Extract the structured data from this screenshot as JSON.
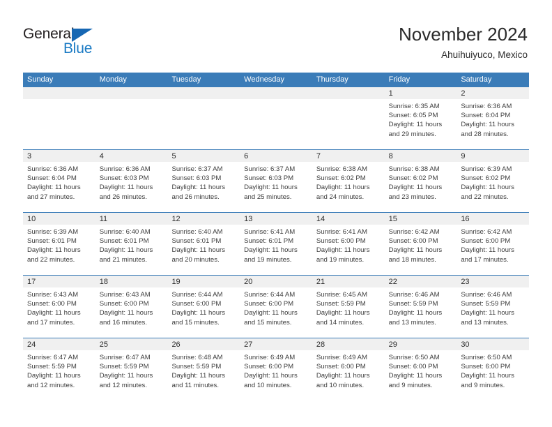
{
  "brand": {
    "name_part1": "General",
    "name_part2": "Blue",
    "triangle_color": "#1667b3",
    "blue_color": "#1a7ac4"
  },
  "header": {
    "title": "November 2024",
    "subtitle": "Ahuihuiyuco, Mexico",
    "header_bg": "#3b7cb8",
    "header_text_color": "#ffffff",
    "day_strip_bg": "#f0f0f0"
  },
  "weekdays": [
    "Sunday",
    "Monday",
    "Tuesday",
    "Wednesday",
    "Thursday",
    "Friday",
    "Saturday"
  ],
  "weeks": [
    [
      {
        "day": "",
        "sunrise": "",
        "sunset": "",
        "daylight1": "",
        "daylight2": ""
      },
      {
        "day": "",
        "sunrise": "",
        "sunset": "",
        "daylight1": "",
        "daylight2": ""
      },
      {
        "day": "",
        "sunrise": "",
        "sunset": "",
        "daylight1": "",
        "daylight2": ""
      },
      {
        "day": "",
        "sunrise": "",
        "sunset": "",
        "daylight1": "",
        "daylight2": ""
      },
      {
        "day": "",
        "sunrise": "",
        "sunset": "",
        "daylight1": "",
        "daylight2": ""
      },
      {
        "day": "1",
        "sunrise": "Sunrise: 6:35 AM",
        "sunset": "Sunset: 6:05 PM",
        "daylight1": "Daylight: 11 hours",
        "daylight2": "and 29 minutes."
      },
      {
        "day": "2",
        "sunrise": "Sunrise: 6:36 AM",
        "sunset": "Sunset: 6:04 PM",
        "daylight1": "Daylight: 11 hours",
        "daylight2": "and 28 minutes."
      }
    ],
    [
      {
        "day": "3",
        "sunrise": "Sunrise: 6:36 AM",
        "sunset": "Sunset: 6:04 PM",
        "daylight1": "Daylight: 11 hours",
        "daylight2": "and 27 minutes."
      },
      {
        "day": "4",
        "sunrise": "Sunrise: 6:36 AM",
        "sunset": "Sunset: 6:03 PM",
        "daylight1": "Daylight: 11 hours",
        "daylight2": "and 26 minutes."
      },
      {
        "day": "5",
        "sunrise": "Sunrise: 6:37 AM",
        "sunset": "Sunset: 6:03 PM",
        "daylight1": "Daylight: 11 hours",
        "daylight2": "and 26 minutes."
      },
      {
        "day": "6",
        "sunrise": "Sunrise: 6:37 AM",
        "sunset": "Sunset: 6:03 PM",
        "daylight1": "Daylight: 11 hours",
        "daylight2": "and 25 minutes."
      },
      {
        "day": "7",
        "sunrise": "Sunrise: 6:38 AM",
        "sunset": "Sunset: 6:02 PM",
        "daylight1": "Daylight: 11 hours",
        "daylight2": "and 24 minutes."
      },
      {
        "day": "8",
        "sunrise": "Sunrise: 6:38 AM",
        "sunset": "Sunset: 6:02 PM",
        "daylight1": "Daylight: 11 hours",
        "daylight2": "and 23 minutes."
      },
      {
        "day": "9",
        "sunrise": "Sunrise: 6:39 AM",
        "sunset": "Sunset: 6:02 PM",
        "daylight1": "Daylight: 11 hours",
        "daylight2": "and 22 minutes."
      }
    ],
    [
      {
        "day": "10",
        "sunrise": "Sunrise: 6:39 AM",
        "sunset": "Sunset: 6:01 PM",
        "daylight1": "Daylight: 11 hours",
        "daylight2": "and 22 minutes."
      },
      {
        "day": "11",
        "sunrise": "Sunrise: 6:40 AM",
        "sunset": "Sunset: 6:01 PM",
        "daylight1": "Daylight: 11 hours",
        "daylight2": "and 21 minutes."
      },
      {
        "day": "12",
        "sunrise": "Sunrise: 6:40 AM",
        "sunset": "Sunset: 6:01 PM",
        "daylight1": "Daylight: 11 hours",
        "daylight2": "and 20 minutes."
      },
      {
        "day": "13",
        "sunrise": "Sunrise: 6:41 AM",
        "sunset": "Sunset: 6:01 PM",
        "daylight1": "Daylight: 11 hours",
        "daylight2": "and 19 minutes."
      },
      {
        "day": "14",
        "sunrise": "Sunrise: 6:41 AM",
        "sunset": "Sunset: 6:00 PM",
        "daylight1": "Daylight: 11 hours",
        "daylight2": "and 19 minutes."
      },
      {
        "day": "15",
        "sunrise": "Sunrise: 6:42 AM",
        "sunset": "Sunset: 6:00 PM",
        "daylight1": "Daylight: 11 hours",
        "daylight2": "and 18 minutes."
      },
      {
        "day": "16",
        "sunrise": "Sunrise: 6:42 AM",
        "sunset": "Sunset: 6:00 PM",
        "daylight1": "Daylight: 11 hours",
        "daylight2": "and 17 minutes."
      }
    ],
    [
      {
        "day": "17",
        "sunrise": "Sunrise: 6:43 AM",
        "sunset": "Sunset: 6:00 PM",
        "daylight1": "Daylight: 11 hours",
        "daylight2": "and 17 minutes."
      },
      {
        "day": "18",
        "sunrise": "Sunrise: 6:43 AM",
        "sunset": "Sunset: 6:00 PM",
        "daylight1": "Daylight: 11 hours",
        "daylight2": "and 16 minutes."
      },
      {
        "day": "19",
        "sunrise": "Sunrise: 6:44 AM",
        "sunset": "Sunset: 6:00 PM",
        "daylight1": "Daylight: 11 hours",
        "daylight2": "and 15 minutes."
      },
      {
        "day": "20",
        "sunrise": "Sunrise: 6:44 AM",
        "sunset": "Sunset: 6:00 PM",
        "daylight1": "Daylight: 11 hours",
        "daylight2": "and 15 minutes."
      },
      {
        "day": "21",
        "sunrise": "Sunrise: 6:45 AM",
        "sunset": "Sunset: 5:59 PM",
        "daylight1": "Daylight: 11 hours",
        "daylight2": "and 14 minutes."
      },
      {
        "day": "22",
        "sunrise": "Sunrise: 6:46 AM",
        "sunset": "Sunset: 5:59 PM",
        "daylight1": "Daylight: 11 hours",
        "daylight2": "and 13 minutes."
      },
      {
        "day": "23",
        "sunrise": "Sunrise: 6:46 AM",
        "sunset": "Sunset: 5:59 PM",
        "daylight1": "Daylight: 11 hours",
        "daylight2": "and 13 minutes."
      }
    ],
    [
      {
        "day": "24",
        "sunrise": "Sunrise: 6:47 AM",
        "sunset": "Sunset: 5:59 PM",
        "daylight1": "Daylight: 11 hours",
        "daylight2": "and 12 minutes."
      },
      {
        "day": "25",
        "sunrise": "Sunrise: 6:47 AM",
        "sunset": "Sunset: 5:59 PM",
        "daylight1": "Daylight: 11 hours",
        "daylight2": "and 12 minutes."
      },
      {
        "day": "26",
        "sunrise": "Sunrise: 6:48 AM",
        "sunset": "Sunset: 5:59 PM",
        "daylight1": "Daylight: 11 hours",
        "daylight2": "and 11 minutes."
      },
      {
        "day": "27",
        "sunrise": "Sunrise: 6:49 AM",
        "sunset": "Sunset: 6:00 PM",
        "daylight1": "Daylight: 11 hours",
        "daylight2": "and 10 minutes."
      },
      {
        "day": "28",
        "sunrise": "Sunrise: 6:49 AM",
        "sunset": "Sunset: 6:00 PM",
        "daylight1": "Daylight: 11 hours",
        "daylight2": "and 10 minutes."
      },
      {
        "day": "29",
        "sunrise": "Sunrise: 6:50 AM",
        "sunset": "Sunset: 6:00 PM",
        "daylight1": "Daylight: 11 hours",
        "daylight2": "and 9 minutes."
      },
      {
        "day": "30",
        "sunrise": "Sunrise: 6:50 AM",
        "sunset": "Sunset: 6:00 PM",
        "daylight1": "Daylight: 11 hours",
        "daylight2": "and 9 minutes."
      }
    ]
  ]
}
